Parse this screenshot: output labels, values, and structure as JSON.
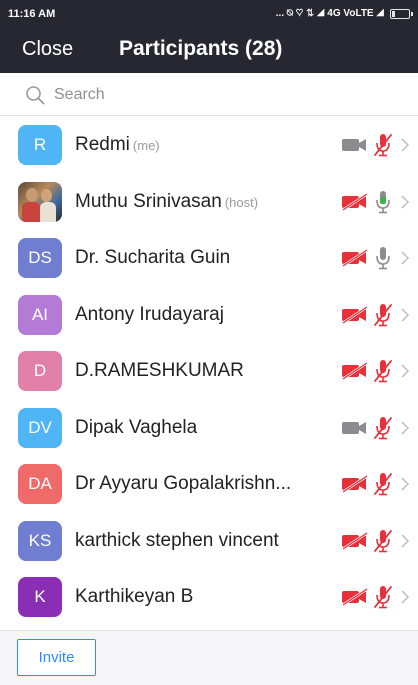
{
  "status_bar": {
    "time": "11:16 AM",
    "indicators": "... ⍉ ♡ ⇅ ◢ 4G VoLTE ◢",
    "battery_level": 0.15
  },
  "header": {
    "close_label": "Close",
    "title": "Participants (28)"
  },
  "search": {
    "placeholder": "Search",
    "value": ""
  },
  "participants": [
    {
      "initials": "R",
      "name": "Redmi",
      "tag": "(me)",
      "avatar_color": "#4fb5f5",
      "video": "off-gray",
      "mic": "muted"
    },
    {
      "initials": "",
      "name": "Muthu Srinivasan",
      "tag": "(host)",
      "avatar_color": "photo",
      "video": "off-red",
      "mic": "active-green"
    },
    {
      "initials": "DS",
      "name": "Dr. Sucharita Guin",
      "tag": "",
      "avatar_color": "#6f7ed0",
      "video": "off-red",
      "mic": "unmuted-gray"
    },
    {
      "initials": "AI",
      "name": "Antony Irudayaraj",
      "tag": "",
      "avatar_color": "#b37ad6",
      "video": "off-red",
      "mic": "muted"
    },
    {
      "initials": "D",
      "name": "D.RAMESHKUMAR",
      "tag": "",
      "avatar_color": "#e07fa8",
      "video": "off-red",
      "mic": "muted"
    },
    {
      "initials": "DV",
      "name": "Dipak Vaghela",
      "tag": "",
      "avatar_color": "#4fb5f5",
      "video": "off-gray",
      "mic": "muted"
    },
    {
      "initials": "DA",
      "name": "Dr Ayyaru Gopalakrishn...",
      "tag": "",
      "avatar_color": "#f06a6a",
      "video": "off-red",
      "mic": "muted"
    },
    {
      "initials": "KS",
      "name": "karthick stephen vincent",
      "tag": "",
      "avatar_color": "#6f7ed0",
      "video": "off-red",
      "mic": "muted"
    },
    {
      "initials": "K",
      "name": "Karthikeyan B",
      "tag": "",
      "avatar_color": "#8a2fb5",
      "video": "off-red",
      "mic": "muted"
    }
  ],
  "footer": {
    "invite_label": "Invite"
  },
  "colors": {
    "header_bg": "#262731",
    "muted_red": "#e8303a",
    "active_green": "#3cb54a",
    "gray_icon": "#8c8c90",
    "accent_blue": "#2d8cff"
  },
  "icons": {
    "search": "search-icon",
    "video": "video-camera-icon",
    "mic": "microphone-icon",
    "chevron": "chevron-right-icon"
  }
}
